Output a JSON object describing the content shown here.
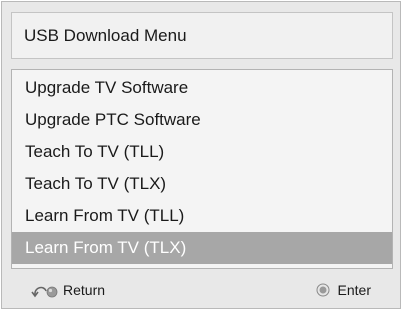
{
  "dialog": {
    "title": "USB Download Menu"
  },
  "menu": {
    "items": [
      {
        "label": "Upgrade TV Software",
        "selected": false
      },
      {
        "label": "Upgrade PTC Software",
        "selected": false
      },
      {
        "label": "Teach To TV (TLL)",
        "selected": false
      },
      {
        "label": "Teach To TV (TLX)",
        "selected": false
      },
      {
        "label": "Learn From TV (TLL)",
        "selected": false
      },
      {
        "label": "Learn From TV (TLX)",
        "selected": true
      }
    ]
  },
  "footer": {
    "return_label": "Return",
    "return_icon": "return-icon",
    "enter_label": "Enter",
    "enter_icon": "enter-icon"
  },
  "colors": {
    "selection": "#a7a7a7",
    "panel": "#e8e8e8",
    "menu_bg": "#f4f4f4"
  }
}
